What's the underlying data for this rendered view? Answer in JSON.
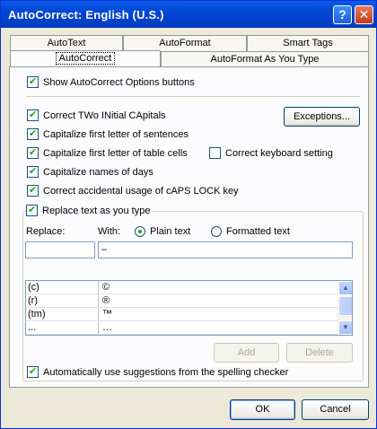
{
  "window": {
    "title": "AutoCorrect: English (U.S.)",
    "help_label": "?",
    "close_label": "✕"
  },
  "tabs": {
    "row1": [
      "AutoText",
      "AutoFormat",
      "Smart Tags"
    ],
    "row2": [
      "AutoCorrect",
      "AutoFormat As You Type"
    ],
    "active": "AutoCorrect"
  },
  "options": {
    "show_buttons": "Show AutoCorrect Options buttons",
    "two_initials": "Correct TWo INitial CApitals",
    "exceptions_button": "Exceptions...",
    "first_letter_sentences": "Capitalize first letter of sentences",
    "first_letter_table": "Capitalize first letter of table cells",
    "keyboard_setting": "Correct keyboard setting",
    "names_of_days": "Capitalize names of days",
    "caps_lock": "Correct accidental usage of cAPS LOCK key",
    "replace_as_you_type": "Replace text as you type"
  },
  "replace": {
    "replace_label": "Replace:",
    "with_label": "With:",
    "plain_text": "Plain text",
    "formatted_text": "Formatted text",
    "replace_value": "",
    "with_value": "–",
    "entries": [
      {
        "from": "(c)",
        "to": "©"
      },
      {
        "from": "(r)",
        "to": "®"
      },
      {
        "from": "(tm)",
        "to": "™"
      },
      {
        "from": "...",
        "to": "…"
      }
    ],
    "add_button": "Add",
    "delete_button": "Delete",
    "spelling_suggestions": "Automatically use suggestions from the spelling checker"
  },
  "footer": {
    "ok_button": "OK",
    "cancel_button": "Cancel"
  }
}
